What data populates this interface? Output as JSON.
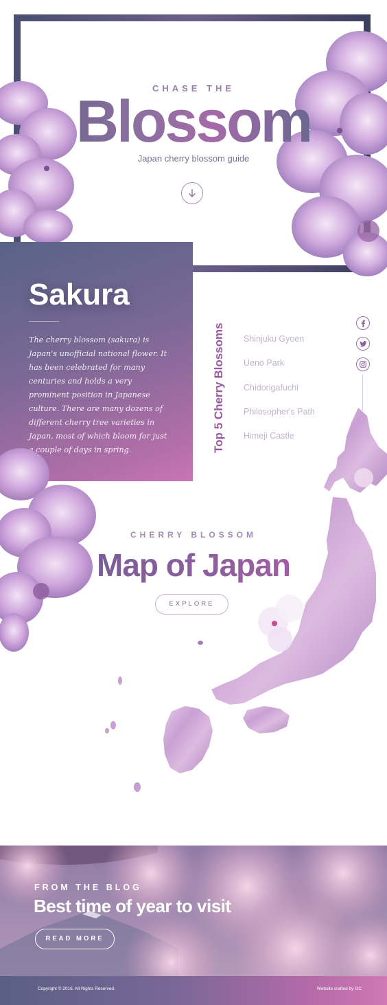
{
  "hero": {
    "kicker": "CHASE THE",
    "title": "Blossom",
    "subtitle": "Japan cherry blossom guide",
    "scroll_icon": "arrow-down-icon"
  },
  "sakura": {
    "title": "Sakura",
    "text": "The cherry blossom (sakura) is Japan's unofficial national flower. It has been celebrated for many centuries and holds a very prominent position in Japanese culture. There are many dozens of different cherry tree varieties in Japan, most of which bloom for just a couple of days in spring."
  },
  "top5": {
    "heading": "Top 5 Cherry Blossoms",
    "items": [
      "Shinjuku Gyoen",
      "Ueno Park",
      "Chidorigafuchi",
      "Philosopher's Path",
      "Himeji Castle"
    ]
  },
  "social": {
    "icons": [
      "facebook-icon",
      "twitter-icon",
      "instagram-icon"
    ]
  },
  "map": {
    "kicker": "CHERRY BLOSSOM",
    "title": "Map of Japan",
    "button": "EXPLORE"
  },
  "blog": {
    "kicker": "FROM THE BLOG",
    "title": "Best time of year to visit",
    "button": "READ MORE"
  },
  "footer": {
    "copyright": "Copyright © 2016. All Rights Reserved.",
    "credit": "Website crafted by GC"
  },
  "colors": {
    "frame": "#4a4f73",
    "accent_purple": "#9a5aa0",
    "panel_start": "#586386",
    "panel_end": "#c775b3"
  }
}
